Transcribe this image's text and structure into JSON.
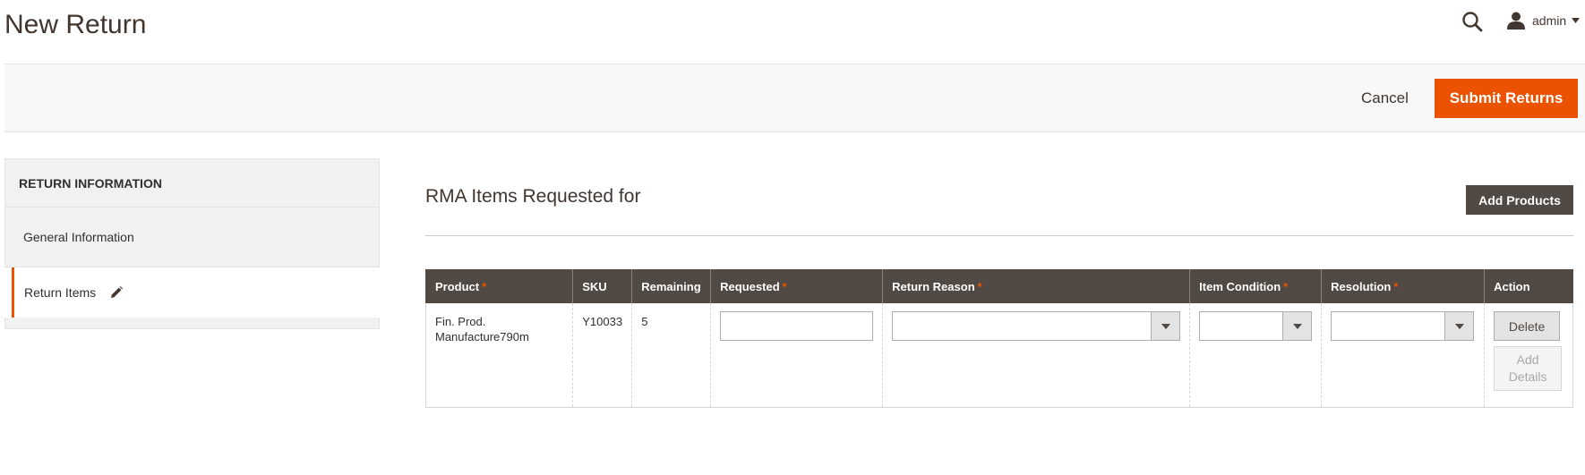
{
  "header": {
    "title": "New Return",
    "user_label": "admin"
  },
  "actions": {
    "cancel_label": "Cancel",
    "submit_label": "Submit Returns"
  },
  "sidebar": {
    "title": "RETURN INFORMATION",
    "items": [
      {
        "label": "General Information",
        "active": false
      },
      {
        "label": "Return Items",
        "active": true,
        "icon": "pencil-icon"
      }
    ]
  },
  "main": {
    "section_title": "RMA Items Requested for",
    "add_products_label": "Add Products",
    "table": {
      "columns": [
        {
          "label": "Product",
          "required": true
        },
        {
          "label": "SKU",
          "required": false
        },
        {
          "label": "Remaining",
          "required": false
        },
        {
          "label": "Requested",
          "required": true
        },
        {
          "label": "Return Reason",
          "required": true
        },
        {
          "label": "Item Condition",
          "required": true
        },
        {
          "label": "Resolution",
          "required": true
        },
        {
          "label": "Action",
          "required": false
        }
      ],
      "required_marker": "*",
      "rows": [
        {
          "product_line1": "Fin. Prod.",
          "product_line2": "Manufacture790m",
          "sku": "Y10033",
          "remaining": "5",
          "requested": "",
          "return_reason": "",
          "item_condition": "",
          "resolution": "",
          "delete_label": "Delete",
          "add_details_line1": "Add",
          "add_details_line2": "Details"
        }
      ]
    }
  },
  "colors": {
    "accent": "#eb5202",
    "header_dark": "#514943",
    "panel_bg": "#f1f1f1"
  }
}
